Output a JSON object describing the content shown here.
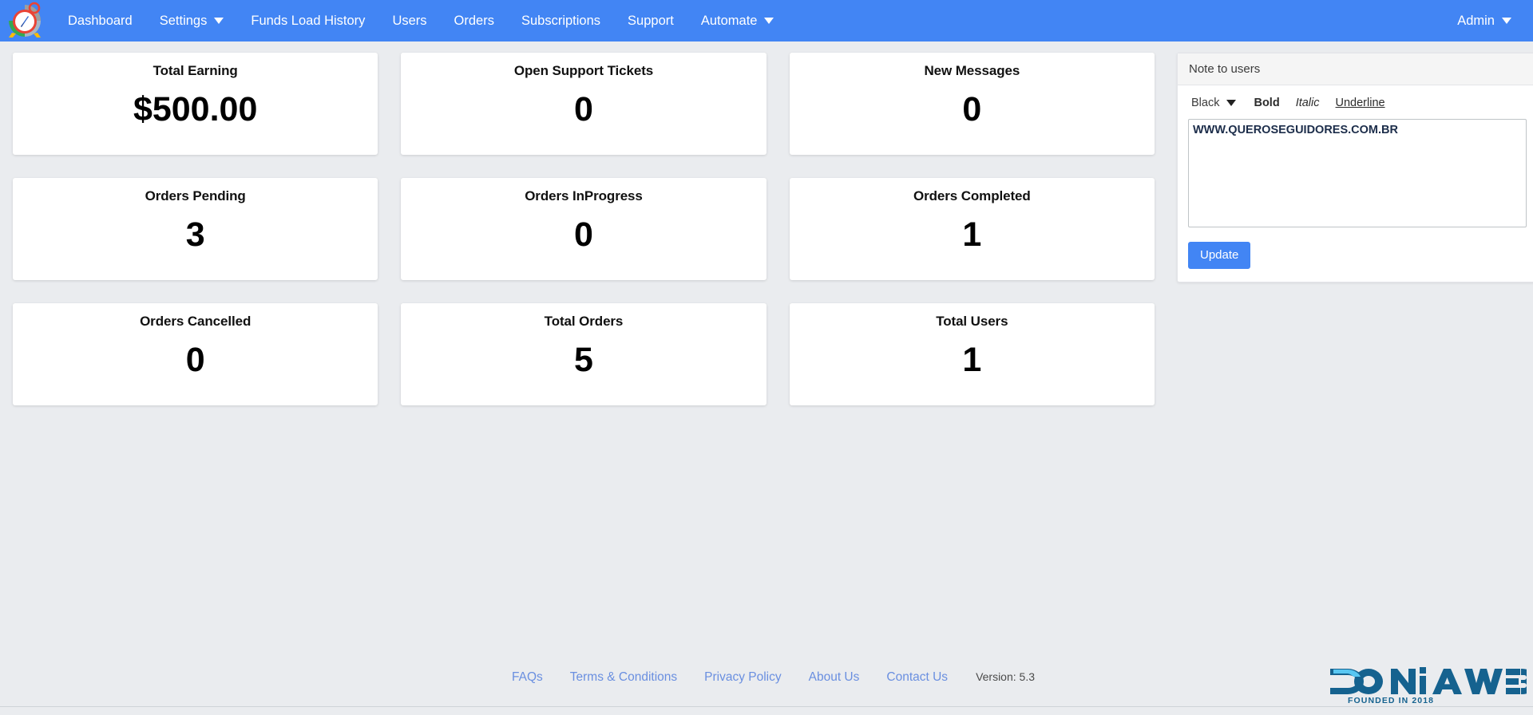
{
  "theme": {
    "navbar_bg": "#4285f4",
    "page_bg": "#eaecef",
    "card_bg": "#ffffff",
    "accent": "#4285f4",
    "footer_link": "#6a8fe0",
    "logo_dark_blue": "#15628f",
    "logo_light_blue": "#59c7f2"
  },
  "navbar": {
    "brand_icon": "alarm-clock-compass-logo",
    "items": [
      {
        "label": "Dashboard",
        "has_caret": false
      },
      {
        "label": "Settings",
        "has_caret": true
      },
      {
        "label": "Funds Load History",
        "has_caret": false
      },
      {
        "label": "Users",
        "has_caret": false
      },
      {
        "label": "Orders",
        "has_caret": false
      },
      {
        "label": "Subscriptions",
        "has_caret": false
      },
      {
        "label": "Support",
        "has_caret": false
      },
      {
        "label": "Automate",
        "has_caret": true
      }
    ],
    "account": {
      "label": "Admin",
      "has_caret": true
    }
  },
  "stats": {
    "rows": [
      [
        {
          "title": "Total Earning",
          "value": "$500.00"
        },
        {
          "title": "Open Support Tickets",
          "value": "0"
        },
        {
          "title": "New Messages",
          "value": "0"
        }
      ],
      [
        {
          "title": "Orders Pending",
          "value": "3"
        },
        {
          "title": "Orders InProgress",
          "value": "0"
        },
        {
          "title": "Orders Completed",
          "value": "1"
        }
      ],
      [
        {
          "title": "Orders Cancelled",
          "value": "0"
        },
        {
          "title": "Total Orders",
          "value": "5"
        },
        {
          "title": "Total Users",
          "value": "1"
        }
      ]
    ]
  },
  "note_panel": {
    "header": "Note to users",
    "toolbar": {
      "color_select": "Black",
      "bold": "Bold",
      "italic": "Italic",
      "underline": "Underline"
    },
    "textarea_value": "WWW.QUEROSEGUIDORES.COM.BR",
    "textarea_placeholder": "",
    "update_label": "Update"
  },
  "footer": {
    "links": [
      "FAQs",
      "Terms & Conditions",
      "Privacy Policy",
      "About Us",
      "Contact Us"
    ],
    "version": "Version: 5.3",
    "logo": {
      "name": "DONiAWEB",
      "tagline": "FOUNDED IN 2018"
    }
  }
}
